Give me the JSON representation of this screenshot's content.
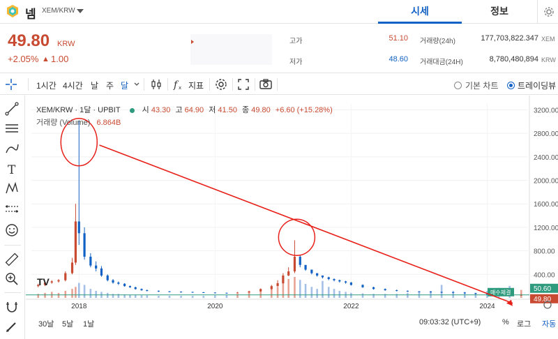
{
  "header": {
    "coin_name": "넴",
    "coin_pair": "XEM/KRW",
    "tabs": [
      {
        "label": "시세",
        "active": true
      },
      {
        "label": "정보",
        "active": false
      }
    ]
  },
  "summary": {
    "price": "49.80",
    "unit": "KRW",
    "change_pct": "+2.05%",
    "change_arrow": "▲",
    "change_abs": "1.00",
    "high_label": "고가",
    "high_value": "51.10",
    "low_label": "저가",
    "low_value": "48.60",
    "volume_label": "거래량(24h)",
    "volume_value": "177,703,822.347",
    "volume_unit": "XEM",
    "amount_label": "거래대금(24H)",
    "amount_value": "8,780,480,894",
    "amount_unit": "KRW"
  },
  "toolbar": {
    "intervals": [
      "1시간",
      "4시간",
      "날",
      "주",
      "달"
    ],
    "active_interval": "달",
    "indicator_label": "지표",
    "chart_modes": [
      {
        "label": "기본 차트",
        "selected": false
      },
      {
        "label": "트레이딩뷰",
        "selected": true
      }
    ]
  },
  "legend": {
    "symbol": "XEM/KRW · 1달 · UPBIT",
    "open_label": "시",
    "open": "43.30",
    "high_label": "고",
    "high": "64.90",
    "low_label": "저",
    "low": "41.50",
    "close_label": "종",
    "close": "49.80",
    "change": "+6.60 (+15.28%)",
    "volume_label": "거래량 (Volume)",
    "volume": "6.864B"
  },
  "badges": {
    "high_price": "50.60",
    "last_price": "49.80",
    "marker": "매수체결"
  },
  "bottom": {
    "ranges": [
      "30날",
      "5날",
      "1날"
    ],
    "clock": "09:03:32 (UTC+9)",
    "pct": "%",
    "log": "로그",
    "auto": "자동"
  },
  "colors": {
    "up": "#c84a31",
    "down": "#1261c4",
    "accent": "#1261c4",
    "annotation": "#e8201a",
    "baseline": "#2e9a7e"
  },
  "chart_data": {
    "type": "bar",
    "x_ticks": [
      "2018",
      "2020",
      "2022",
      "2024"
    ],
    "y_ticks": [
      "3200.00",
      "2800.00",
      "2400.00",
      "2000.00",
      "1600.00",
      "1200.00",
      "800.00",
      "400.00"
    ],
    "ylim": [
      0,
      3300
    ],
    "x_range": [
      2017.3,
      2024.6
    ],
    "series": [
      {
        "x": [
          2017.4,
          2017.5,
          2017.6,
          2017.7,
          2017.8,
          2017.9,
          2017.95,
          2018.0,
          2018.08,
          2018.17,
          2018.25,
          2018.33,
          2018.42,
          2018.5,
          2018.58,
          2018.67,
          2018.75,
          2018.83,
          2018.92,
          2019.0,
          2019.17,
          2019.33,
          2019.5,
          2019.67,
          2019.83,
          2020.0,
          2020.17,
          2020.33,
          2020.5,
          2020.67,
          2020.83,
          2020.92,
          2021.0,
          2021.08,
          2021.17,
          2021.25,
          2021.33,
          2021.42,
          2021.5,
          2021.58,
          2021.67,
          2021.75,
          2021.83,
          2021.92,
          2022.0,
          2022.17,
          2022.33,
          2022.5,
          2022.67,
          2022.83,
          2023.0,
          2023.17,
          2023.33,
          2023.5,
          2023.67,
          2023.83,
          2024.0,
          2024.17,
          2024.33,
          2024.5
        ],
        "open": [
          200,
          220,
          260,
          280,
          300,
          420,
          600,
          1300,
          1100,
          700,
          550,
          500,
          380,
          300,
          260,
          240,
          200,
          180,
          150,
          130,
          120,
          110,
          105,
          100,
          95,
          90,
          85,
          80,
          90,
          110,
          150,
          200,
          250,
          380,
          450,
          700,
          560,
          480,
          420,
          380,
          350,
          320,
          300,
          280,
          260,
          220,
          180,
          150,
          130,
          120,
          110,
          105,
          100,
          95,
          90,
          80,
          70,
          60,
          55,
          43
        ],
        "close": [
          220,
          260,
          280,
          300,
          420,
          600,
          1300,
          1100,
          700,
          550,
          500,
          380,
          300,
          260,
          240,
          200,
          180,
          150,
          130,
          120,
          110,
          105,
          100,
          95,
          90,
          85,
          80,
          90,
          110,
          150,
          200,
          250,
          380,
          450,
          700,
          560,
          480,
          420,
          380,
          350,
          320,
          300,
          280,
          260,
          220,
          180,
          150,
          130,
          120,
          110,
          105,
          100,
          95,
          90,
          80,
          70,
          60,
          55,
          43,
          49.8
        ],
        "high": [
          240,
          280,
          300,
          320,
          450,
          680,
          1600,
          3020,
          1200,
          760,
          620,
          540,
          400,
          320,
          280,
          250,
          210,
          190,
          160,
          140,
          125,
          115,
          110,
          105,
          100,
          95,
          90,
          100,
          120,
          160,
          220,
          300,
          420,
          520,
          980,
          720,
          540,
          460,
          410,
          380,
          360,
          330,
          310,
          290,
          270,
          230,
          190,
          160,
          140,
          125,
          115,
          110,
          105,
          100,
          95,
          85,
          75,
          65,
          64.9,
          64.9
        ],
        "low": [
          180,
          200,
          240,
          260,
          280,
          400,
          560,
          900,
          650,
          520,
          450,
          360,
          280,
          240,
          220,
          190,
          170,
          140,
          120,
          110,
          100,
          95,
          90,
          88,
          85,
          80,
          75,
          75,
          85,
          105,
          140,
          190,
          240,
          370,
          420,
          520,
          460,
          400,
          360,
          330,
          300,
          280,
          260,
          240,
          210,
          170,
          140,
          120,
          110,
          100,
          95,
          90,
          85,
          80,
          70,
          60,
          55,
          45,
          41.5,
          41.5
        ],
        "volume": [
          8,
          10,
          12,
          10,
          14,
          18,
          22,
          30,
          26,
          18,
          14,
          12,
          10,
          8,
          8,
          7,
          6,
          6,
          5,
          5,
          4,
          4,
          4,
          4,
          4,
          5,
          6,
          8,
          10,
          14,
          18,
          22,
          30,
          38,
          42,
          36,
          28,
          22,
          18,
          34,
          22,
          18,
          14,
          12,
          10,
          9,
          8,
          8,
          8,
          10,
          12,
          14,
          26,
          14,
          12,
          10,
          14,
          20,
          24,
          16
        ]
      }
    ]
  }
}
